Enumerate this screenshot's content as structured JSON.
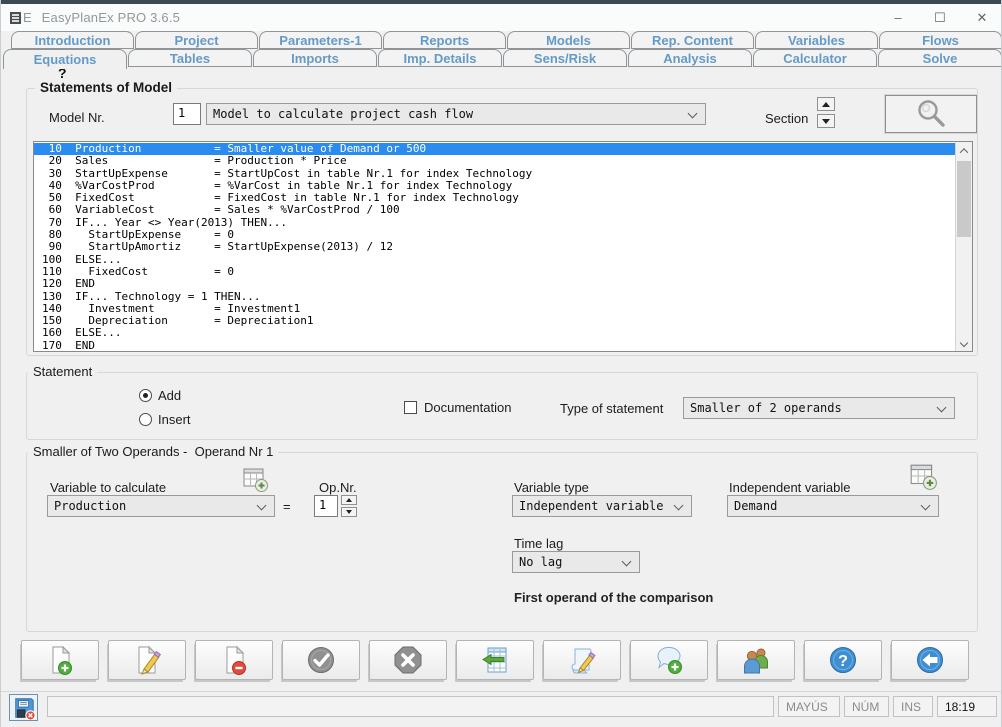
{
  "window": {
    "title": "EasyPlanEx PRO  3.6.5",
    "icon_letter": "E",
    "controls": {
      "minimize": "–",
      "maximize": "☐",
      "close": "✕"
    }
  },
  "tabs": {
    "row1": [
      "Introduction",
      "Project",
      "Parameters-1",
      "Reports",
      "Models",
      "Rep. Content",
      "Variables",
      "Flows"
    ],
    "row2": [
      "Equations",
      "Tables",
      "Imports",
      "Imp. Details",
      "Sens/Risk",
      "Analysis",
      "Calculator",
      "Solve"
    ],
    "active": "Equations",
    "help_hint": "?"
  },
  "model_header": {
    "group_title": "Statements of Model",
    "model_nr_label": "Model Nr.",
    "model_nr_value": "1",
    "model_name": "Model to calculate project cash flow",
    "section_label": "Section"
  },
  "statements": {
    "selected_index": 0,
    "lines": [
      " 10  Production           = Smaller value of Demand or 500",
      " 20  Sales                = Production * Price",
      " 30  StartUpExpense       = StartUpCost in table Nr.1 for index Technology",
      " 40  %VarCostProd         = %VarCost in table Nr.1 for index Technology",
      " 50  FixedCost            = FixedCost in table Nr.1 for index Technology",
      " 60  VariableCost         = Sales * %VarCostProd / 100",
      " 70  IF... Year <> Year(2013) THEN...",
      " 80    StartUpExpense     = 0",
      " 90    StartUpAmortiz     = StartUpExpense(2013) / 12",
      "100  ELSE...",
      "110    FixedCost          = 0",
      "120  END",
      "130  IF... Technology = 1 THEN...",
      "140    Investment         = Investment1",
      "150    Depreciation       = Depreciation1",
      "160  ELSE...",
      "170  END"
    ]
  },
  "statement_group": {
    "title": "Statement",
    "add_label": "Add",
    "insert_label": "Insert",
    "documentation_label": "Documentation",
    "type_label": "Type of statement",
    "type_value": "Smaller of 2 operands"
  },
  "operand_group": {
    "title": "Smaller of Two Operands -  Operand Nr 1",
    "variable_to_calculate_label": "Variable to calculate",
    "variable_to_calculate_value": "Production",
    "equals_sign": "=",
    "op_nr_label": "Op.Nr.",
    "op_nr_value": "1",
    "variable_type_label": "Variable type",
    "variable_type_value": "Independent variable",
    "independent_variable_label": "Independent variable",
    "independent_variable_value": "Demand",
    "time_lag_label": "Time lag",
    "time_lag_value": "No lag",
    "hint_text": "First operand of the comparison"
  },
  "toolbar": {
    "buttons": [
      "new-document",
      "edit-document",
      "delete-document",
      "confirm",
      "cancel",
      "table-return",
      "documentation-sheet",
      "add-comment",
      "users",
      "help",
      "back"
    ]
  },
  "statusbar": {
    "message": "",
    "caps_label": "MAYÚS",
    "num_label": "NÚM",
    "ins_label": "INS",
    "time": "18:19"
  },
  "colors": {
    "selection_blue": "#2b8cf0",
    "tab_text_blue": "#649ac8",
    "icon_blue": "#3f8ed2",
    "icon_green": "#4fae3c",
    "icon_red": "#e04b3c",
    "icon_gray": "#909090"
  }
}
